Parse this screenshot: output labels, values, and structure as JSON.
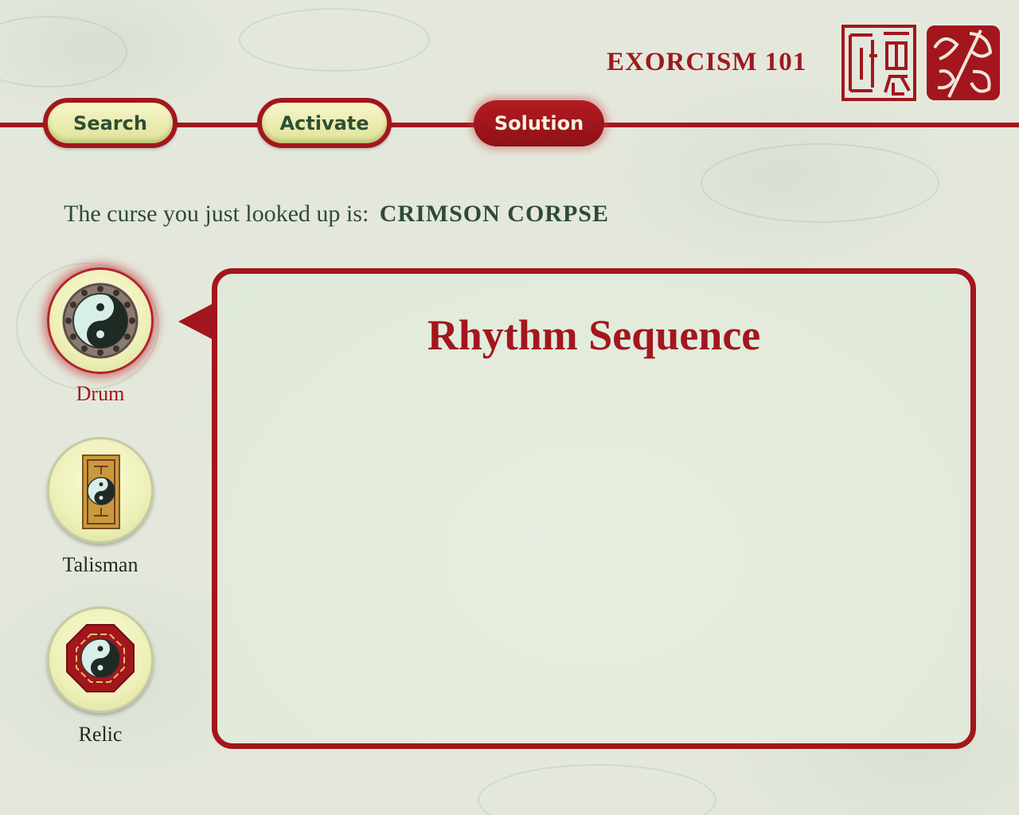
{
  "header": {
    "app_title": "EXORCISM 101"
  },
  "tabs": [
    {
      "label": "Search",
      "active": false
    },
    {
      "label": "Activate",
      "active": false
    },
    {
      "label": "Solution",
      "active": true
    }
  ],
  "curse": {
    "prefix": "The curse you just looked up is:",
    "name": "CRIMSON CORPSE"
  },
  "tools": [
    {
      "label": "Drum",
      "icon": "drum-icon",
      "selected": true
    },
    {
      "label": "Talisman",
      "icon": "talisman-icon",
      "selected": false
    },
    {
      "label": "Relic",
      "icon": "relic-icon",
      "selected": false
    }
  ],
  "panel": {
    "title": "Rhythm Sequence"
  },
  "colors": {
    "accent": "#a3161d",
    "text_green": "#2e4a3a",
    "background": "#e4e8dc"
  }
}
